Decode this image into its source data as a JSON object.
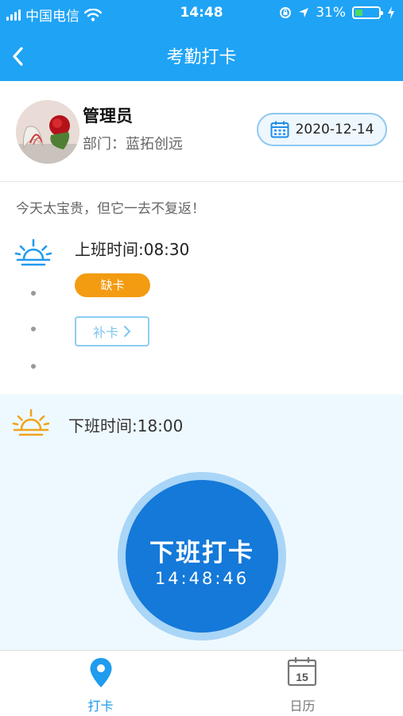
{
  "status_bar": {
    "carrier": "中国电信",
    "time": "14:48",
    "battery": "31%",
    "battery_level": 0.31
  },
  "nav": {
    "title": "考勤打卡"
  },
  "profile": {
    "name": "管理员",
    "department": "部门：蓝拓创远",
    "date": "2020-12-14"
  },
  "motto": "今天太宝贵，但它一去不复返！",
  "onduty": {
    "label": "上班时间:08:30",
    "status": "缺卡",
    "makeup_button": "补卡"
  },
  "offduty": {
    "label": "下班时间:18:00"
  },
  "punch": {
    "title": "下班打卡",
    "clock": "14:48:46"
  },
  "tabs": [
    {
      "label": "打卡",
      "active": true
    },
    {
      "label": "日历",
      "active": false,
      "icon_text": "15"
    }
  ],
  "colors": {
    "primary": "#1fa3f5",
    "button": "#1479d9",
    "warning": "#f39c12",
    "sun_on": "#1f9bef",
    "sun_off": "#f0a31a"
  }
}
